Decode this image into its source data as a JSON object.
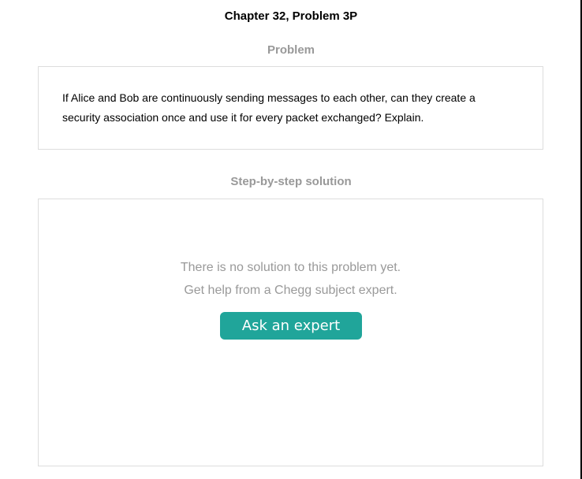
{
  "header": {
    "title": "Chapter 32, Problem 3P"
  },
  "problem": {
    "heading": "Problem",
    "text": "If Alice and Bob are continuously sending messages to each other, can they create a security association once and use it for every packet exchanged? Explain."
  },
  "solution": {
    "heading": "Step-by-step solution",
    "line1": "There is no solution to this problem yet.",
    "line2": "Get help from a Chegg subject expert.",
    "button_label": "Ask an expert"
  },
  "colors": {
    "accent": "#20a59a"
  }
}
